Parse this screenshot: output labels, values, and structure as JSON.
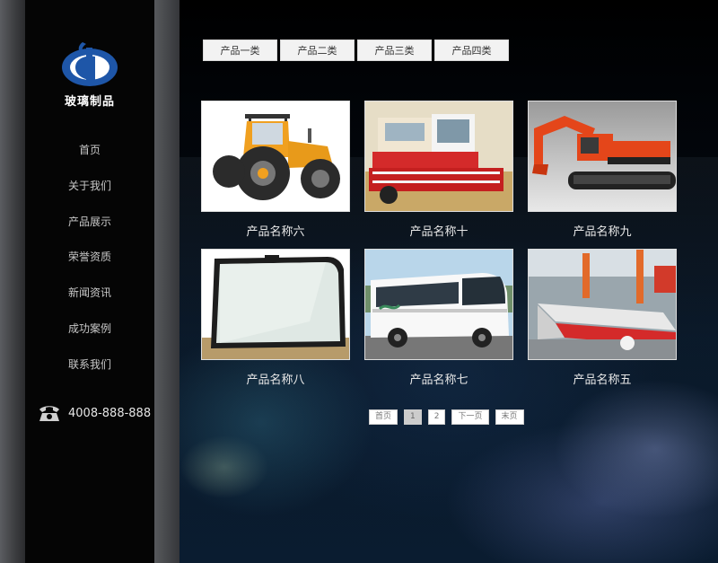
{
  "brand": {
    "name": "玻璃制品"
  },
  "nav": [
    "首页",
    "关于我们",
    "产品展示",
    "荣誉资质",
    "新闻资讯",
    "成功案例",
    "联系我们"
  ],
  "phone": "4008-888-888",
  "tabs": [
    "产品一类",
    "产品二类",
    "产品三类",
    "产品四类"
  ],
  "products": [
    {
      "name": "产品名称六",
      "image": "tractor"
    },
    {
      "name": "产品名称十",
      "image": "combine-harvester"
    },
    {
      "name": "产品名称九",
      "image": "excavator"
    },
    {
      "name": "产品名称八",
      "image": "glass-panel"
    },
    {
      "name": "产品名称七",
      "image": "bus"
    },
    {
      "name": "产品名称五",
      "image": "factory-line"
    }
  ],
  "pager": {
    "first": "首页",
    "pages": [
      "1",
      "2"
    ],
    "current": "1",
    "next": "下一页",
    "last": "末页"
  },
  "colors": {
    "accent": "#1d4f9c",
    "tab_bg": "#f2f2f2"
  }
}
